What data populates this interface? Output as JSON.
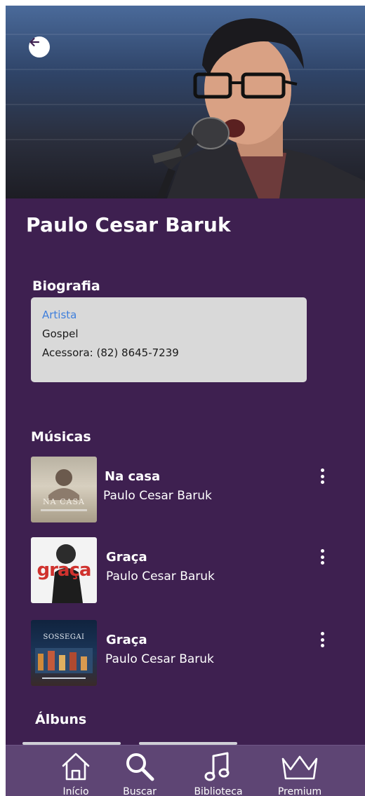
{
  "artist": {
    "name": "Paulo Cesar Baruk"
  },
  "biography": {
    "title": "Biografia",
    "type": "Artista",
    "genre": "Gospel",
    "contact": "Acessora: (82) 8645-7239"
  },
  "songs": {
    "title": "Músicas",
    "items": [
      {
        "title": "Na casa",
        "artist": "Paulo Cesar Baruk",
        "cover_text": "NA CASA"
      },
      {
        "title": "Graça",
        "artist": "Paulo Cesar Baruk",
        "cover_text": "graça"
      },
      {
        "title": "Graça",
        "artist": "Paulo Cesar Baruk",
        "cover_text": "SOSSEGAI"
      }
    ]
  },
  "albums": {
    "title": "Álbuns"
  },
  "nav": {
    "items": [
      {
        "label": "Início",
        "icon": "home-icon"
      },
      {
        "label": "Buscar",
        "icon": "search-icon"
      },
      {
        "label": "Biblioteca",
        "icon": "music-note-icon"
      },
      {
        "label": "Premium",
        "icon": "crown-icon"
      }
    ]
  },
  "colors": {
    "background": "#3e2050",
    "nav_background": "#5e4574",
    "card_background": "#d9d9d9",
    "link_blue": "#3f7fdc"
  }
}
